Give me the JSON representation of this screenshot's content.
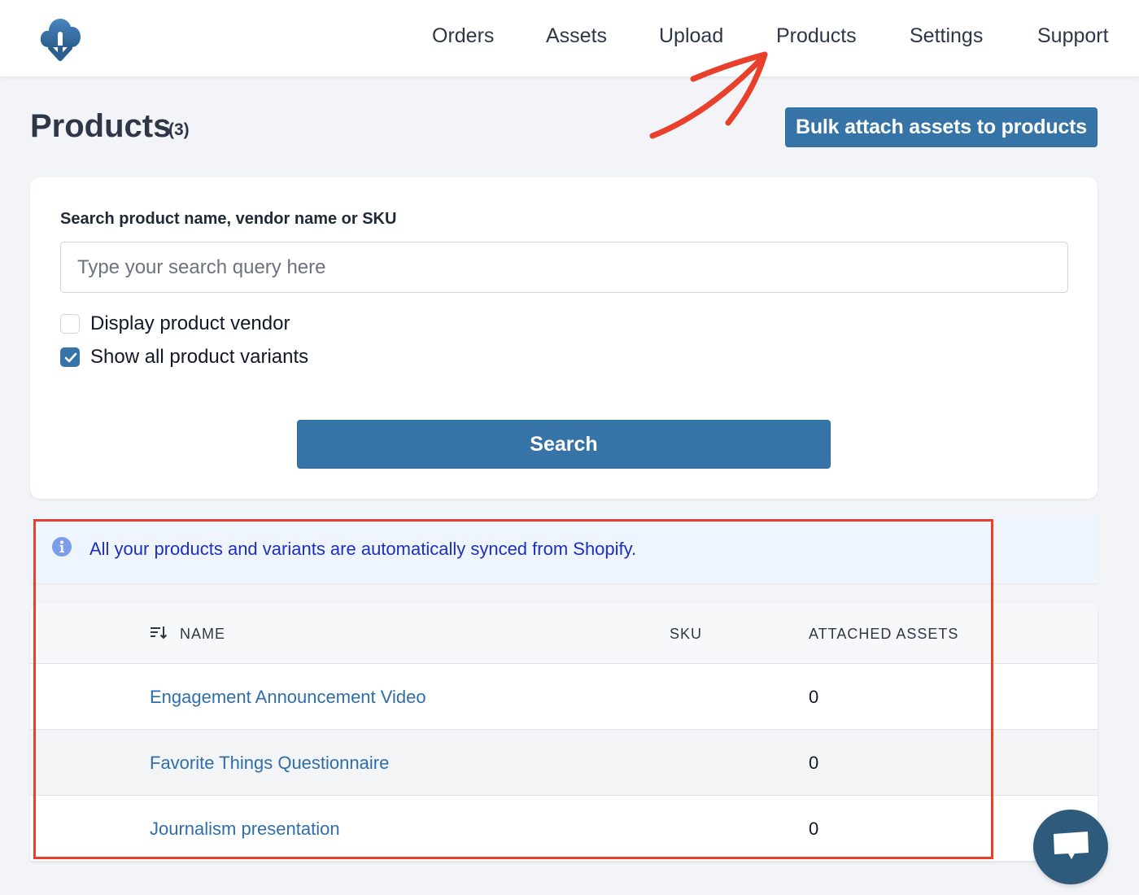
{
  "header": {
    "logo_icon": "cloud-download-icon",
    "nav": [
      {
        "label": "Orders"
      },
      {
        "label": "Assets"
      },
      {
        "label": "Upload"
      },
      {
        "label": "Products"
      },
      {
        "label": "Settings"
      },
      {
        "label": "Support"
      }
    ]
  },
  "page": {
    "title": "Products",
    "count": "(3)",
    "bulk_button_label": "Bulk attach assets to products"
  },
  "search": {
    "label": "Search product name, vendor name or SKU",
    "placeholder": "Type your search query here",
    "value": "",
    "options": [
      {
        "label": "Display product vendor",
        "checked": false
      },
      {
        "label": "Show all product variants",
        "checked": true
      }
    ],
    "button_label": "Search"
  },
  "info_banner": {
    "icon": "info-icon",
    "text": "All your products and variants are automatically synced from Shopify."
  },
  "table": {
    "sort_icon": "sort-descending-icon",
    "columns": [
      "NAME",
      "SKU",
      "ATTACHED ASSETS"
    ],
    "rows": [
      {
        "name": "Engagement Announcement Video",
        "sku": "",
        "attached_assets": "0"
      },
      {
        "name": "Favorite Things Questionnaire",
        "sku": "",
        "attached_assets": "0"
      },
      {
        "name": "Journalism presentation",
        "sku": "",
        "attached_assets": "0"
      }
    ]
  },
  "chat_widget": {
    "icon": "chat-bubble-icon"
  },
  "colors": {
    "primary": "#3673a6",
    "link": "#2f6ea8",
    "info_text": "#1e2fb8",
    "info_bg": "#eef5ff",
    "annotation": "#e8402a",
    "chat_bg": "#2e5a7c"
  }
}
